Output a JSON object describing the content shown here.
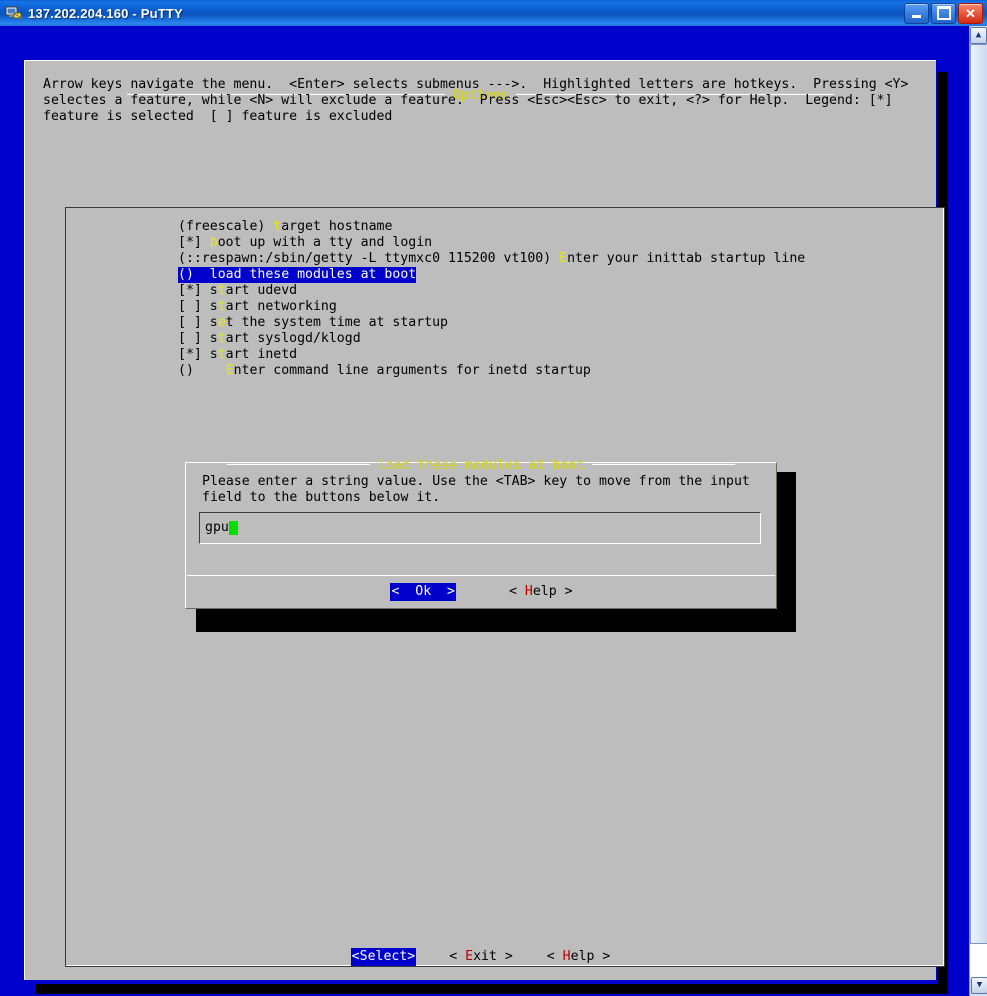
{
  "window": {
    "title": "137.202.204.160 - PuTTY",
    "icon": "putty-computer-icon",
    "controls": {
      "minimize_label": "_",
      "maximize_label": "□",
      "close_label": "×"
    }
  },
  "colors": {
    "terminal_background": "#0000cc",
    "surface": "#bdbdbd",
    "frame_title": "#d8d800",
    "hotkey": "#e8e800",
    "selection_background": "#0000cc",
    "selection_text": "#ffffff",
    "button_hotkey": "#bb0000",
    "cursor": "#00e000",
    "titlebar_text": "#ffffff"
  },
  "scrollbar": {
    "up_arrow": "▲",
    "down_arrow": "▼"
  },
  "screen": {
    "frame_title": "Options",
    "frame_title_left_rule": "──────────────────────────────────────── ",
    "frame_title_right_rule": " ────────────────────────────────────────",
    "help_line_1": "Arrow keys navigate the menu.  <Enter> selects submenus --->.  Highlighted letters are hotkeys.  Pressing <Y>",
    "help_line_2": "selectes a feature, while <N> will exclude a feature.  Press <Esc><Esc> to exit, <?> for Help.  Legend: [*]",
    "help_line_3": "feature is selected  [ ] feature is excluded"
  },
  "menu": {
    "items": [
      {
        "prefix": "(freescale) ",
        "hotkey": "t",
        "text": "arget hostname",
        "selected": false
      },
      {
        "prefix": "[*] ",
        "hotkey": "b",
        "text": "oot up with a tty and login",
        "selected": false
      },
      {
        "prefix": "(::respawn:/sbin/getty -L ttymxc0 115200 vt100) ",
        "hotkey": "E",
        "text": "nter your inittab startup line",
        "selected": false
      },
      {
        "prefix": "()  ",
        "hotkey": "",
        "text": "load these modules at boot",
        "selected": true
      },
      {
        "prefix": "[*] s",
        "hotkey": "t",
        "text": "art udevd",
        "selected": false
      },
      {
        "prefix": "[ ] s",
        "hotkey": "t",
        "text": "art networking",
        "selected": false
      },
      {
        "prefix": "[ ] s",
        "hotkey": "e",
        "text": "t the system time at startup",
        "selected": false
      },
      {
        "prefix": "[ ] s",
        "hotkey": "t",
        "text": "art syslogd/klogd",
        "selected": false
      },
      {
        "prefix": "[*] s",
        "hotkey": "t",
        "text": "art inetd",
        "selected": false
      },
      {
        "prefix": "()    ",
        "hotkey": "E",
        "text": "nter command line arguments for inetd startup",
        "selected": false
      }
    ]
  },
  "footer_buttons": [
    {
      "left": "<",
      "pre": "",
      "hotkey": "S",
      "post": "elect",
      "right": ">",
      "active": true
    },
    {
      "left": "< ",
      "pre": "",
      "hotkey": "E",
      "post": "xit",
      "right": " >",
      "active": false
    },
    {
      "left": "< ",
      "pre": "",
      "hotkey": "H",
      "post": "elp",
      "right": " >",
      "active": false
    }
  ],
  "dialog": {
    "title": "load these modules at boot",
    "title_left_rule": "────────────────── ",
    "title_right_rule": " ──────────────────",
    "text_line_1": "Please enter a string value. Use the <TAB> key to move from the input",
    "text_line_2": "field to the buttons below it.",
    "input": {
      "value": "gpu",
      "placeholder": ""
    },
    "buttons": [
      {
        "left": "<  ",
        "pre": "",
        "hotkey": "O",
        "post": "k",
        "right": "  >",
        "active": true
      },
      {
        "left": "< ",
        "pre": "",
        "hotkey": "H",
        "post": "elp",
        "right": " >",
        "active": false
      }
    ]
  }
}
